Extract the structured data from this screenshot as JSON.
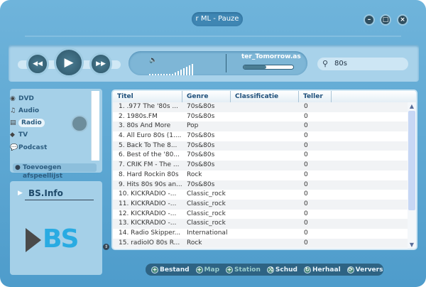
{
  "window": {
    "title": "r ML - Pauze",
    "minimize": "–",
    "maximize": "□",
    "close": "×"
  },
  "player": {
    "rewind": "◀◀",
    "play": "▶",
    "forward": "▶▶",
    "track": "ter_Tomorrow.as",
    "progress": 0.45,
    "volume_level": 1.0
  },
  "search": {
    "value": "80s"
  },
  "sidebar": {
    "items": [
      {
        "label": "DVD",
        "icon": "disc-icon"
      },
      {
        "label": "Audio",
        "icon": "headphones-icon"
      },
      {
        "label": "Radio",
        "icon": "radio-icon"
      },
      {
        "label": "TV",
        "icon": "tv-icon"
      },
      {
        "label": "Podcast",
        "icon": "podcast-icon"
      }
    ],
    "selected": "Radio",
    "add_playlist": "Toevoegen afspeellijst"
  },
  "info": {
    "title": "BS.Info",
    "logo": "BS"
  },
  "table": {
    "columns": [
      "Titel",
      "Genre",
      "Classificatie",
      "Teller"
    ],
    "rows": [
      [
        "1. .977 The '80s ...",
        "70s&80s",
        "",
        "0"
      ],
      [
        "2. 1980s.FM",
        "70s&80s",
        "",
        "0"
      ],
      [
        "3. 80s And More",
        "Pop",
        "",
        "0"
      ],
      [
        "4. All Euro 80s (1....",
        "70s&80s",
        "",
        "0"
      ],
      [
        "5. Back To The 8...",
        "70s&80s",
        "",
        "0"
      ],
      [
        "6. Best of the '80...",
        "70s&80s",
        "",
        "0"
      ],
      [
        "7. CRIK FM - The ...",
        "70s&80s",
        "",
        "0"
      ],
      [
        "8. Hard Rockin 80s",
        "Rock",
        "",
        "0"
      ],
      [
        "9. Hits 80s 90s an...",
        "70s&80s",
        "",
        "0"
      ],
      [
        "10. KICKRADIO -...",
        "Classic_rock",
        "",
        "0"
      ],
      [
        "11. KICKRADIO -...",
        "Classic_rock",
        "",
        "0"
      ],
      [
        "12. KICKRADIO -...",
        "Classic_rock",
        "",
        "0"
      ],
      [
        "13. KICKRADIO -...",
        "Classic_rock",
        "",
        "0"
      ],
      [
        "14. Radio Skipper...",
        "International",
        "",
        "0"
      ],
      [
        "15. radioIO 80s R...",
        "Rock",
        "",
        "0"
      ]
    ]
  },
  "bottom": {
    "buttons": [
      "Bestand",
      "Map",
      "Station",
      "Schud",
      "Herhaal",
      "Ververs"
    ]
  }
}
